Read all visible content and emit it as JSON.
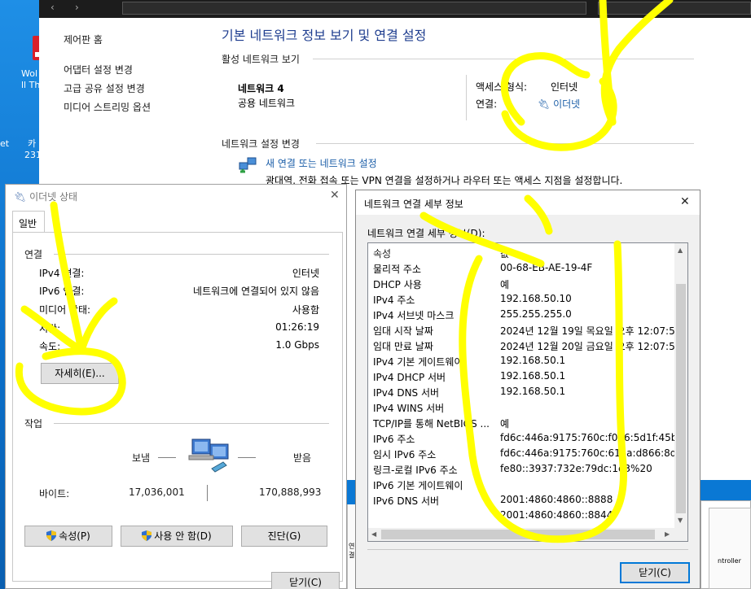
{
  "desktop": {
    "labels": [
      "Wol",
      "ll Th",
      "et",
      "카",
      "231"
    ]
  },
  "control_panel": {
    "sidebar": [
      "제어판 홈",
      "어댑터 설정 변경",
      "고급 공유 설정 변경",
      "미디어 스트리밍 옵션"
    ],
    "title": "기본 네트워크 정보 보기 및 연결 설정",
    "active_networks_heading": "활성 네트워크 보기",
    "network_name": "네트워크 4",
    "network_type": "공용 네트워크",
    "access_type_label": "액세스 형식:",
    "access_type_value": "인터넷",
    "connections_label": "연결:",
    "connections_value": "이더넷",
    "change_settings_heading": "네트워크 설정 변경",
    "new_connection_link": "새 연결 또는 네트워크 설정",
    "new_connection_desc": "광대역, 전화 접속 또는 VPN 연결을 설정하거나 라우터 또는 액세스 지점을 설정합니다."
  },
  "ethernet_status": {
    "title": "이더넷 상태",
    "tab": "일반",
    "connection_heading": "연결",
    "rows": [
      {
        "label": "IPv4 연결:",
        "value": "인터넷"
      },
      {
        "label": "IPv6 연결:",
        "value": "네트워크에 연결되어 있지 않음"
      },
      {
        "label": "미디어 상태:",
        "value": "사용함"
      },
      {
        "label": "시간:",
        "value": "01:26:19"
      },
      {
        "label": "속도:",
        "value": "1.0 Gbps"
      }
    ],
    "details_button": "자세히(E)...",
    "activity_heading": "작업",
    "sent_label": "보냄",
    "received_label": "받음",
    "bytes_label": "바이트:",
    "bytes_sent": "17,036,001",
    "bytes_received": "170,888,993",
    "properties_button": "속성(P)",
    "disable_button": "사용 안 함(D)",
    "diagnose_button": "진단(G)",
    "close_button": "닫기(C)"
  },
  "details": {
    "title": "네트워크 연결 세부 정보",
    "subtitle": "네트워크 연결 세부 정보(D):",
    "header": {
      "property": "속성",
      "value": "값"
    },
    "rows": [
      {
        "property": "물리적 주소",
        "value": "00-68-EB-AE-19-4F"
      },
      {
        "property": "DHCP 사용",
        "value": "예"
      },
      {
        "property": "IPv4 주소",
        "value": "192.168.50.10"
      },
      {
        "property": "IPv4 서브넷 마스크",
        "value": "255.255.255.0"
      },
      {
        "property": "임대 시작 날짜",
        "value": "2024년 12월 19일 목요일 오후 12:07:5"
      },
      {
        "property": "임대 만료 날짜",
        "value": "2024년 12월 20일 금요일 오후 12:07:5"
      },
      {
        "property": "IPv4 기본 게이트웨이",
        "value": "192.168.50.1"
      },
      {
        "property": "IPv4 DHCP 서버",
        "value": "192.168.50.1"
      },
      {
        "property": "IPv4 DNS 서버",
        "value": "192.168.50.1"
      },
      {
        "property": "IPv4 WINS 서버",
        "value": ""
      },
      {
        "property": "TCP/IP를 통해 NetBIOS ...",
        "value": "예"
      },
      {
        "property": "IPv6 주소",
        "value": "fd6c:446a:9175:760c:f096:5d1f:45bb:4"
      },
      {
        "property": "임시 IPv6 주소",
        "value": "fd6c:446a:9175:760c:61aa:d866:8d81:7"
      },
      {
        "property": "링크-로컬 IPv6 주소",
        "value": "fe80::3937:732e:79dc:1e3%20"
      },
      {
        "property": "IPv6 기본 게이트웨이",
        "value": ""
      },
      {
        "property": "IPv6 DNS 서버",
        "value": "2001:4860:4860::8888"
      },
      {
        "property": "",
        "value": "2001:4860:4860::8844"
      }
    ],
    "close_button": "닫기(C)"
  },
  "background": {
    "partial_text": "ntroller",
    "partial_text2": "연결"
  },
  "colors": {
    "link": "#1b5ea8",
    "title": "#1e3d8f",
    "annotation": "#ffff00"
  }
}
